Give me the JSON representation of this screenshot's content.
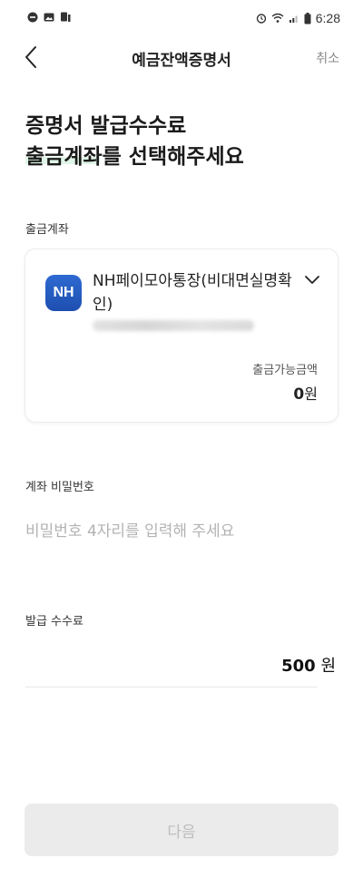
{
  "status_bar": {
    "time": "6:28",
    "left_icons": [
      "minus-circle-icon",
      "image-icon",
      "sim-icon"
    ],
    "right_icons": [
      "alarm-icon",
      "wifi-icon",
      "signal-icon",
      "battery-icon"
    ]
  },
  "header": {
    "title": "예금잔액증명서",
    "cancel_label": "취소"
  },
  "heading": {
    "line1": "증명서 발급수수료",
    "line2": "출금계좌를 선택해주세요"
  },
  "withdraw_account": {
    "label": "출금계좌",
    "bank_logo_text": "NH",
    "account_name": "NH페이모아통장(비대면실명확인)",
    "available_label": "출금가능금액",
    "available_amount": "0",
    "available_unit": "원"
  },
  "password": {
    "label": "계좌 비밀번호",
    "placeholder": "비밀번호 4자리를 입력해 주세요",
    "value": ""
  },
  "fee": {
    "label": "발급 수수료",
    "amount": "500",
    "unit": "원"
  },
  "next_button_label": "다음",
  "colors": {
    "brand_blue": "#1e4fb0",
    "highlight_green": "#d7f3e1",
    "disabled_bg": "#ebebeb",
    "disabled_text": "#bdbdbd"
  }
}
